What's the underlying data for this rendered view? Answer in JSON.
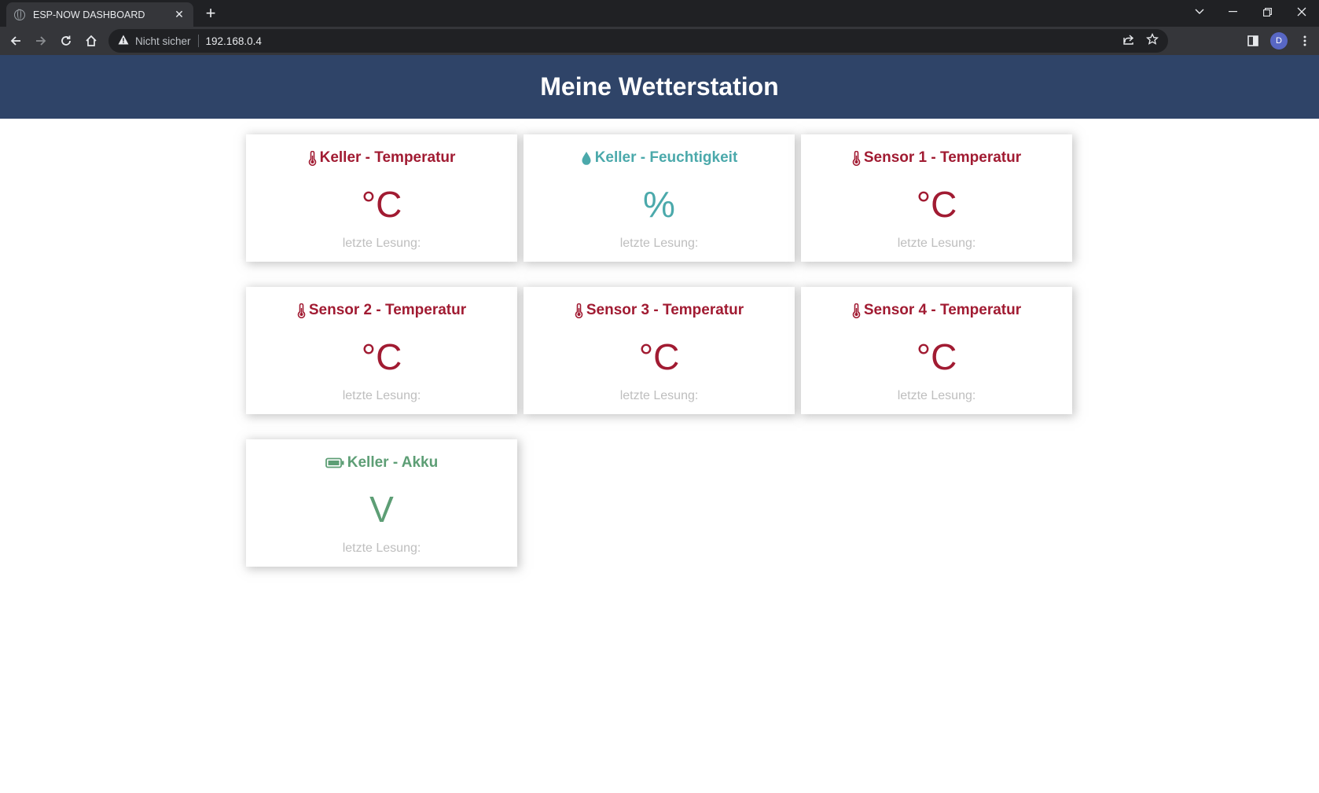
{
  "browser": {
    "tab_title": "ESP-NOW DASHBOARD",
    "tab_close": "✕",
    "new_tab": "+",
    "security_label": "Nicht sicher",
    "url": "192.168.0.4",
    "profile_initial": "D"
  },
  "page": {
    "title": "Meine Wetterstation"
  },
  "cards": [
    {
      "title": "Keller - Temperatur",
      "value": "",
      "unit": "°C",
      "timestamp_label": "letzte Lesung:",
      "icon": "thermometer-icon",
      "kind": "temp"
    },
    {
      "title": "Keller - Feuchtigkeit",
      "value": "",
      "unit": "%",
      "timestamp_label": "letzte Lesung:",
      "icon": "droplet-icon",
      "kind": "hum"
    },
    {
      "title": "Sensor 1 - Temperatur",
      "value": "",
      "unit": "°C",
      "timestamp_label": "letzte Lesung:",
      "icon": "thermometer-icon",
      "kind": "temp"
    },
    {
      "title": "Sensor 2 - Temperatur",
      "value": "",
      "unit": "°C",
      "timestamp_label": "letzte Lesung:",
      "icon": "thermometer-icon",
      "kind": "temp"
    },
    {
      "title": "Sensor 3 - Temperatur",
      "value": "",
      "unit": "°C",
      "timestamp_label": "letzte Lesung:",
      "icon": "thermometer-icon",
      "kind": "temp"
    },
    {
      "title": "Sensor 4 - Temperatur",
      "value": "",
      "unit": "°C",
      "timestamp_label": "letzte Lesung:",
      "icon": "thermometer-icon",
      "kind": "temp"
    },
    {
      "title": "Keller - Akku",
      "value": "",
      "unit": "V",
      "timestamp_label": "letzte Lesung:",
      "icon": "battery-icon",
      "kind": "bat"
    }
  ],
  "colors": {
    "header_bg": "#2f4468",
    "temperature": "#a11b32",
    "humidity": "#4ba9ab",
    "battery": "#5d9e75",
    "timestamp": "#bebebe"
  }
}
